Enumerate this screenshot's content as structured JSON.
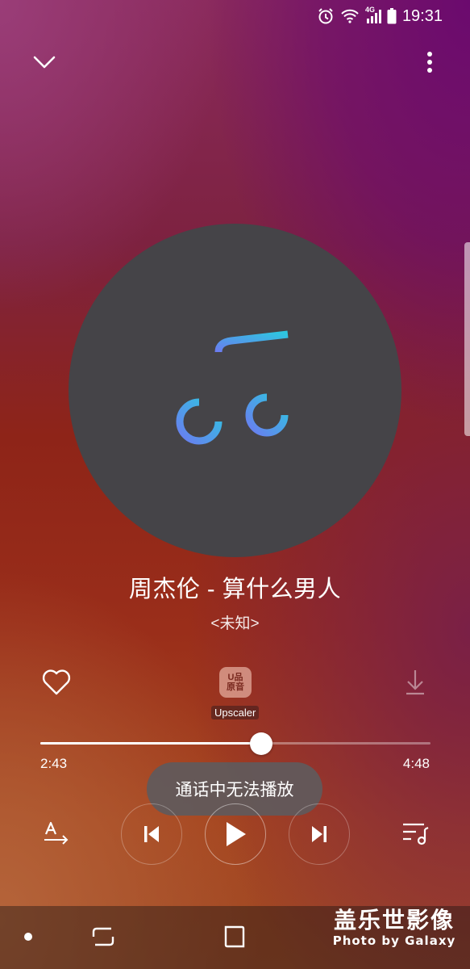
{
  "status_bar": {
    "time": "19:31",
    "network": "4G",
    "icons": [
      "alarm-icon",
      "wifi-icon",
      "signal-icon",
      "battery-icon"
    ]
  },
  "header": {
    "collapse_icon": "chevron-down-icon",
    "menu_icon": "more-vertical-icon"
  },
  "album_art": {
    "icon": "music-note-icon"
  },
  "track": {
    "title": "周杰伦 - 算什么男人",
    "artist": "<未知>"
  },
  "actions": {
    "favorite_icon": "heart-icon",
    "upscaler_badge": "U品\n原音",
    "upscaler_label": "Upscaler",
    "download_icon": "download-icon"
  },
  "progress": {
    "elapsed": "2:43",
    "duration": "4:48",
    "fraction": 0.566
  },
  "toast": {
    "message": "通话中无法播放"
  },
  "controls": {
    "lyrics_icon": "lyrics-icon",
    "prev_icon": "previous-icon",
    "play_icon": "play-icon",
    "next_icon": "next-icon",
    "queue_icon": "playlist-icon"
  },
  "watermark": {
    "main": "盖乐世影像",
    "sub": "Photo by Galaxy"
  },
  "colors": {
    "disc": "#454448",
    "note_gradient_top": "#2ec6e0",
    "note_gradient_bottom": "#6b7cf0"
  }
}
